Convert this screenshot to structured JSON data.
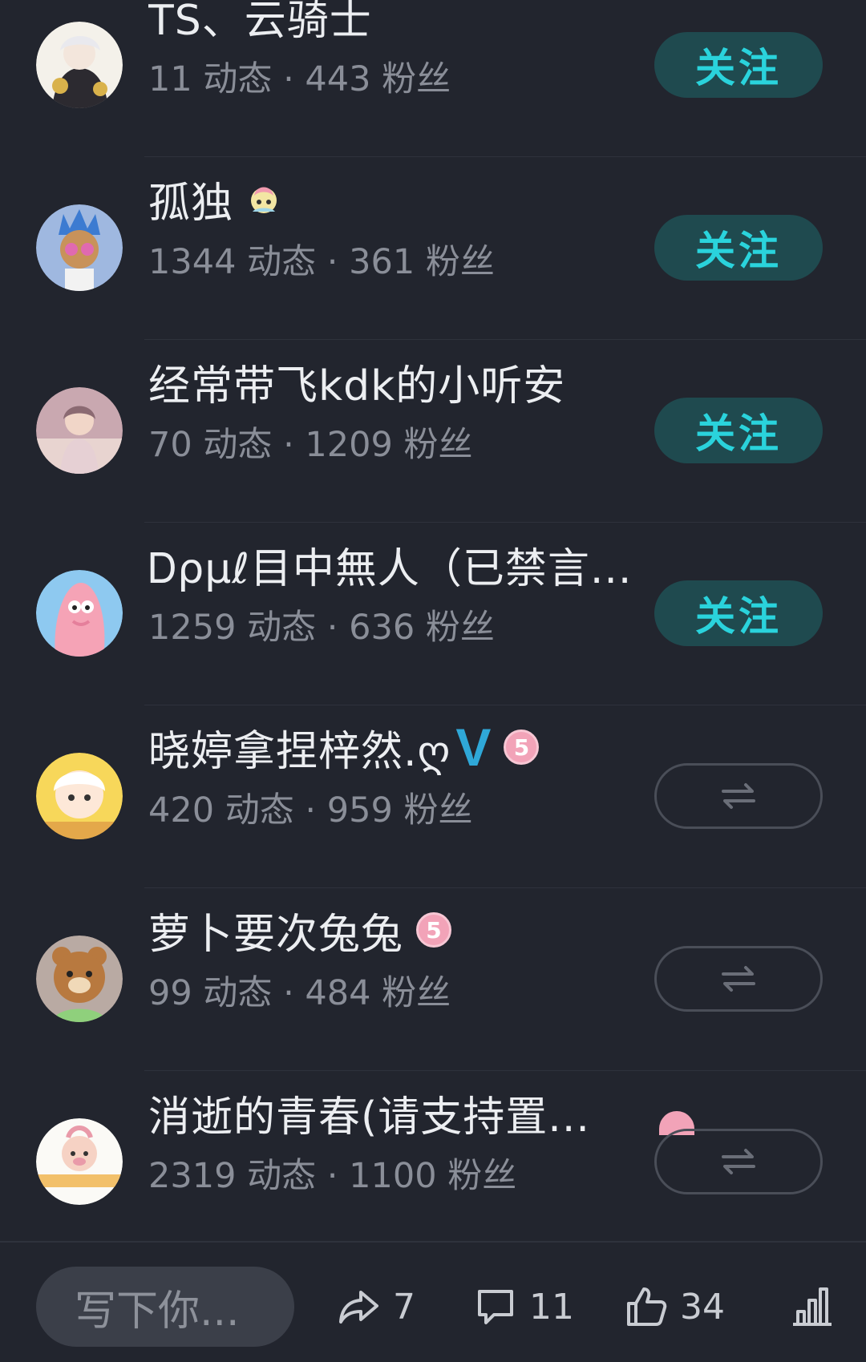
{
  "users": [
    {
      "name": "TS、云骑士",
      "posts": "11",
      "fans": "443",
      "badges": [],
      "action": "follow",
      "avatar_colors": [
        "#f4f1ea",
        "#2c2a30",
        "#d9b24b"
      ]
    },
    {
      "name": "孤独",
      "posts": "1344",
      "fans": "361",
      "badges": [
        "sticker"
      ],
      "action": "follow",
      "avatar_colors": [
        "#9fb8e0",
        "#3c7bd1",
        "#e06ab0"
      ]
    },
    {
      "name": "经常带飞kdk的小听安",
      "posts": "70",
      "fans": "1209",
      "badges": [],
      "action": "follow",
      "avatar_colors": [
        "#c9a8b0",
        "#8b6a72",
        "#e8d4d0"
      ]
    },
    {
      "name": "Ꭰρμℓ目中無人（已禁言...",
      "posts": "1259",
      "fans": "636",
      "badges": [],
      "action": "follow",
      "avatar_colors": [
        "#8ec9f0",
        "#f5a3b6",
        "#e57f9b"
      ]
    },
    {
      "name": "晓婷拿捏梓然.ღ",
      "posts": "420",
      "fans": "959",
      "badges": [
        "v",
        "level"
      ],
      "action": "mutual",
      "avatar_colors": [
        "#f7d75a",
        "#ffffff",
        "#e4a84a"
      ]
    },
    {
      "name": "萝卜要次兔兔",
      "posts": "99",
      "fans": "484",
      "badges": [
        "level"
      ],
      "action": "mutual",
      "avatar_colors": [
        "#b9aaa3",
        "#b8793f",
        "#8fd07c"
      ]
    },
    {
      "name": "消逝的青春(请支持置...",
      "posts": "2319",
      "fans": "1100",
      "badges": [
        "level-peek"
      ],
      "action": "mutual",
      "avatar_colors": [
        "#fbfaf6",
        "#f2c06a",
        "#e99aa9"
      ]
    }
  ],
  "labels": {
    "posts_unit": "动态",
    "fans_unit": "粉丝",
    "separator": "·",
    "follow_button": "关注",
    "level_value": "5",
    "v_badge": "V"
  },
  "bottom_bar": {
    "comment_placeholder": "写下你...",
    "share_count": "7",
    "comment_count": "11",
    "like_count": "34"
  },
  "colors": {
    "background": "#22252e",
    "follow_bg": "#1f4a4f",
    "follow_text": "#2ad3dc",
    "verified_blue": "#2fa8d8",
    "level_pink": "#f2a3b8"
  },
  "icons": [
    "share-icon",
    "comment-icon",
    "like-icon",
    "stats-icon",
    "mutual-follow-icon"
  ]
}
